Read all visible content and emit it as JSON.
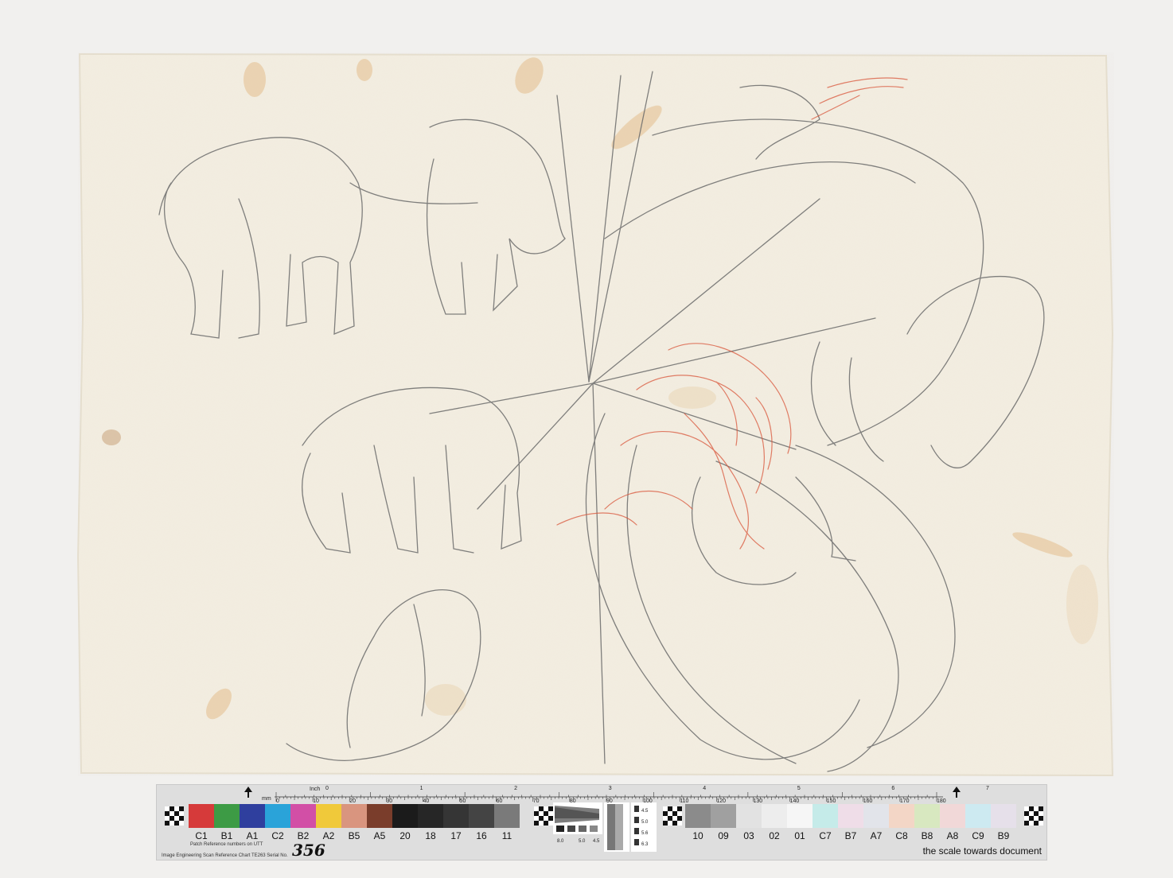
{
  "chart": {
    "ruler": {
      "unit_mm": "mm",
      "unit_inch": "Inch",
      "mm_ticks": [
        "0",
        "10",
        "20",
        "30",
        "40",
        "50",
        "60",
        "70",
        "80",
        "90",
        "100",
        "110",
        "120",
        "130",
        "140",
        "150",
        "160",
        "170",
        "180"
      ],
      "inch_ticks": [
        "0",
        "1",
        "2",
        "3",
        "4",
        "5",
        "6",
        "7"
      ]
    },
    "left_patches": [
      {
        "label": "C1",
        "color": "#d63a3a"
      },
      {
        "label": "B1",
        "color": "#3d9b45"
      },
      {
        "label": "A1",
        "color": "#2f3f9e"
      },
      {
        "label": "C2",
        "color": "#2aa3d9"
      },
      {
        "label": "B2",
        "color": "#d24fa6"
      },
      {
        "label": "A2",
        "color": "#f0c93a"
      },
      {
        "label": "B5",
        "color": "#d9957f"
      },
      {
        "label": "A5",
        "color": "#7a3d2b"
      },
      {
        "label": "20",
        "color": "#1b1b1b"
      },
      {
        "label": "18",
        "color": "#262626"
      },
      {
        "label": "17",
        "color": "#353535"
      },
      {
        "label": "16",
        "color": "#444444"
      },
      {
        "label": "11",
        "color": "#7a7a7a"
      }
    ],
    "right_patches": [
      {
        "label": "10",
        "color": "#8b8b8b"
      },
      {
        "label": "09",
        "color": "#a0a0a0"
      },
      {
        "label": "03",
        "color": "#e2e2e2"
      },
      {
        "label": "02",
        "color": "#ededed"
      },
      {
        "label": "01",
        "color": "#f6f6f6"
      },
      {
        "label": "C7",
        "color": "#c5ebe9"
      },
      {
        "label": "B7",
        "color": "#efdde8"
      },
      {
        "label": "A7",
        "color": "#e2e4ea"
      },
      {
        "label": "C8",
        "color": "#f3d6c6"
      },
      {
        "label": "B8",
        "color": "#d8e8c0"
      },
      {
        "label": "A8",
        "color": "#f1d8d8"
      },
      {
        "label": "C9",
        "color": "#cdeaf1"
      },
      {
        "label": "B9",
        "color": "#e6e0ea"
      }
    ],
    "gray_scale_numbers": [
      "4.5",
      "5.0",
      "5.6",
      "6.3",
      "8.0",
      "5.0",
      "4.5"
    ],
    "patch_reference_text": "Patch Reference numbers on UTT",
    "brand_text": "Image Engineering   Scan Reference Chart   TE263   Serial No.",
    "serial_number": "356",
    "caption": "the scale towards document"
  }
}
